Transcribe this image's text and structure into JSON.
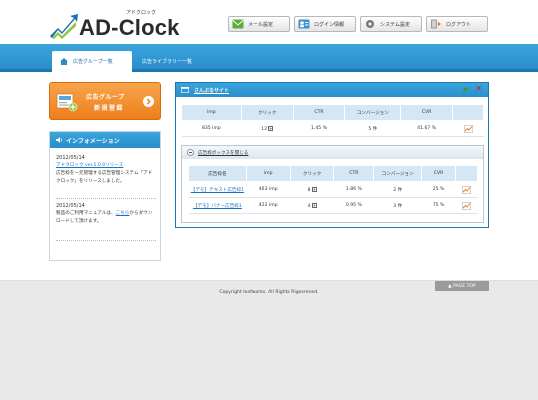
{
  "header": {
    "logo_text": "AD-Clock",
    "logo_sub": "アドクロック",
    "buttons": [
      {
        "label": "メール設定"
      },
      {
        "label": "ログイン情報"
      },
      {
        "label": "システム設定"
      },
      {
        "label": "ログアウト"
      }
    ]
  },
  "nav": {
    "tabs": [
      {
        "label": "広告グループ一覧"
      },
      {
        "label": "広告ライブラリー一覧"
      }
    ]
  },
  "sidebar": {
    "register_button": {
      "line1": "広告グループ",
      "line2": "新規登録"
    },
    "info": {
      "title": "インフォメーション",
      "news": [
        {
          "date": "2012/05/14",
          "link": "アドクロック ver.1.0.0リリース",
          "text": "広告枠を一元管理する広告管理システム「アドクロック」をリリースしました。"
        },
        {
          "date": "2012/05/14",
          "text_before": "製品のご利用マニュアルは、",
          "link": "こちら",
          "text_after": "からダウンロードして頂けます。"
        }
      ]
    }
  },
  "panel": {
    "title": "さんぷるサイト",
    "stats": {
      "headers": [
        "imp",
        "クリック",
        "CTR",
        "コンバージョン",
        "CVR"
      ],
      "row": {
        "imp": "835 imp",
        "click": "12",
        "ctr": "1.45 %",
        "cv": "5 件",
        "cvr": "41.67 %"
      }
    },
    "ad_box": {
      "toggle_label": "広告枠ボックスを閉じる",
      "headers": [
        "広告枠名",
        "imp",
        "クリック",
        "CTR",
        "コンバージョン",
        "CVR"
      ],
      "rows": [
        {
          "name": "【デモ】テキスト広告枠1",
          "imp": "463 imp",
          "click": "8",
          "ctr": "1.86 %",
          "cv": "2 件",
          "cvr": "25 %"
        },
        {
          "name": "【デモ】バナー広告枠1",
          "imp": "422 imp",
          "click": "4",
          "ctr": "0.95 %",
          "cv": "3 件",
          "cvr": "75 %"
        }
      ]
    }
  },
  "footer": {
    "copyright": "Copyright leafworks. All Rights Rigesrened.",
    "pagetop": "▲ PAGE TOP"
  },
  "colors": {
    "nav_blue": "#2a8ecb",
    "accent_orange": "#ee7f1b",
    "link_blue": "#1a73c5",
    "close_red": "#d31a1a"
  }
}
